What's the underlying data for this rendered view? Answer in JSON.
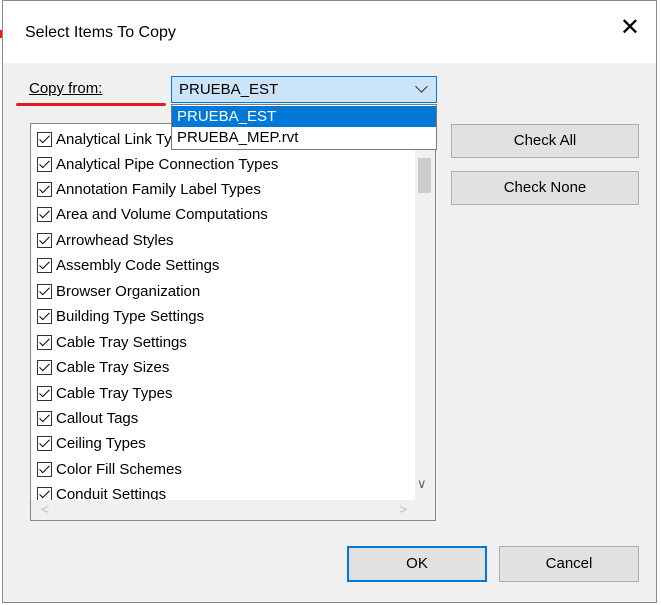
{
  "dialog": {
    "title": "Select Items To Copy",
    "close_glyph": "✕"
  },
  "copy_from": {
    "label": "Copy from:",
    "selected": "PRUEBA_EST",
    "options": [
      "PRUEBA_EST",
      "PRUEBA_MEP.rvt"
    ]
  },
  "items": [
    {
      "label": "Analytical Link Types",
      "checked": true
    },
    {
      "label": "Analytical Pipe Connection Types",
      "checked": true
    },
    {
      "label": "Annotation Family Label Types",
      "checked": true
    },
    {
      "label": "Area and Volume Computations",
      "checked": true
    },
    {
      "label": "Arrowhead Styles",
      "checked": true
    },
    {
      "label": "Assembly Code Settings",
      "checked": true
    },
    {
      "label": "Browser Organization",
      "checked": true
    },
    {
      "label": "Building Type Settings",
      "checked": true
    },
    {
      "label": "Cable Tray Settings",
      "checked": true
    },
    {
      "label": "Cable Tray Sizes",
      "checked": true
    },
    {
      "label": "Cable Tray Types",
      "checked": true
    },
    {
      "label": "Callout Tags",
      "checked": true
    },
    {
      "label": "Ceiling Types",
      "checked": true
    },
    {
      "label": "Color Fill Schemes",
      "checked": true
    },
    {
      "label": "Conduit Settings",
      "checked": true
    }
  ],
  "buttons": {
    "check_all": "Check All",
    "check_none": "Check None",
    "ok": "OK",
    "cancel": "Cancel"
  },
  "colors": {
    "accent": "#0078d7",
    "annotation_red": "#e01b1b"
  },
  "icons": {
    "close": "close-icon",
    "dropdown": "chevron-down-icon",
    "scroll_down": "chevron-down-icon",
    "scroll_left": "chevron-left-icon",
    "scroll_right": "chevron-right-icon"
  }
}
